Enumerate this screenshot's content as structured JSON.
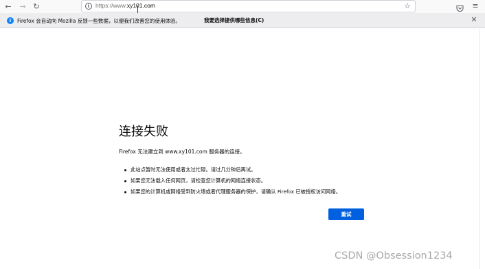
{
  "toolbar": {
    "back_icon": "arrow-left-icon",
    "forward_icon": "arrow-right-icon",
    "reload_icon": "reload-icon",
    "url_prefix": "https://www.",
    "url_host": "xy101.com",
    "bookmark_icon": "star-icon",
    "pocket_icon": "pocket-icon",
    "menu_icon": "hamburger-menu-icon"
  },
  "notification": {
    "icon": "info-icon",
    "text": "Firefox 会自动向 Mozilla 反馈一些数据，以便我们改善您的使用体验。",
    "link_label": "我要选择提供哪些信息(C)",
    "close_icon": "close-icon"
  },
  "error": {
    "title": "连接失败",
    "description": "Firefox 无法建立到 www.xy101.com 服务器的连接。",
    "items": [
      "此站点暂时无法使用或者太过忙碌。请过几分钟后再试。",
      "如果您无法载入任何网页，请检查您计算机的网络连接状态。",
      "如果您的计算机或网络受到防火墙或者代理服务器的保护，请确认 Firefox 已被授权访问网络。"
    ],
    "retry_label": "重试"
  },
  "watermark": "CSDN @Obsession1234"
}
